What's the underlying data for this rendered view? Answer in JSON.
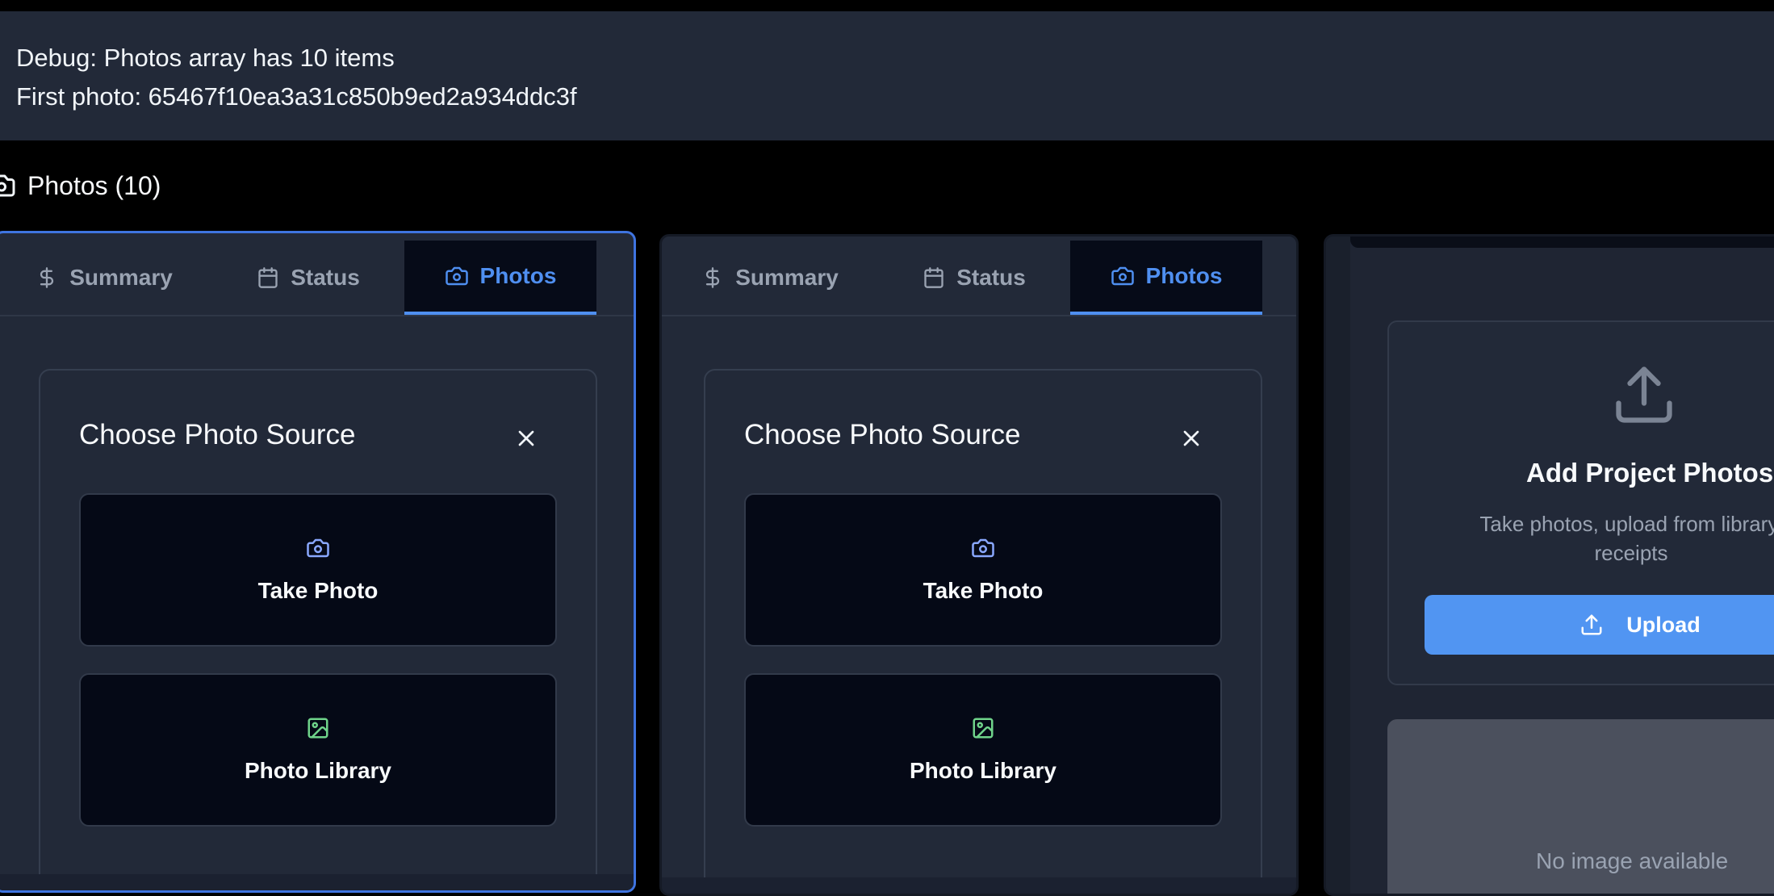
{
  "debug": {
    "line1": "Debug: Photos array has 10 items",
    "line2": "First photo: 65467f10ea3a31c850b9ed2a934ddc3f"
  },
  "section": {
    "title": "Photos (10)",
    "icon": "camera-icon"
  },
  "tabs": [
    {
      "label": "Summary",
      "icon": "dollar-icon"
    },
    {
      "label": "Status",
      "icon": "calendar-icon"
    },
    {
      "label": "Photos",
      "icon": "camera-icon",
      "active": true
    }
  ],
  "dialog": {
    "title": "Choose Photo Source",
    "take_photo": "Take Photo",
    "photo_library": "Photo Library"
  },
  "upload": {
    "title": "Add Project Photos",
    "description": "Take photos, upload from library, receipts",
    "button": "Upload",
    "placeholder": "No image available"
  },
  "colors": {
    "accent": "#4f8ff0",
    "upload_button": "#5195f2",
    "camera_icon": "#8aa8ff",
    "library_icon": "#6fd38a",
    "card_bg": "#222938",
    "button_bg": "#050916"
  }
}
